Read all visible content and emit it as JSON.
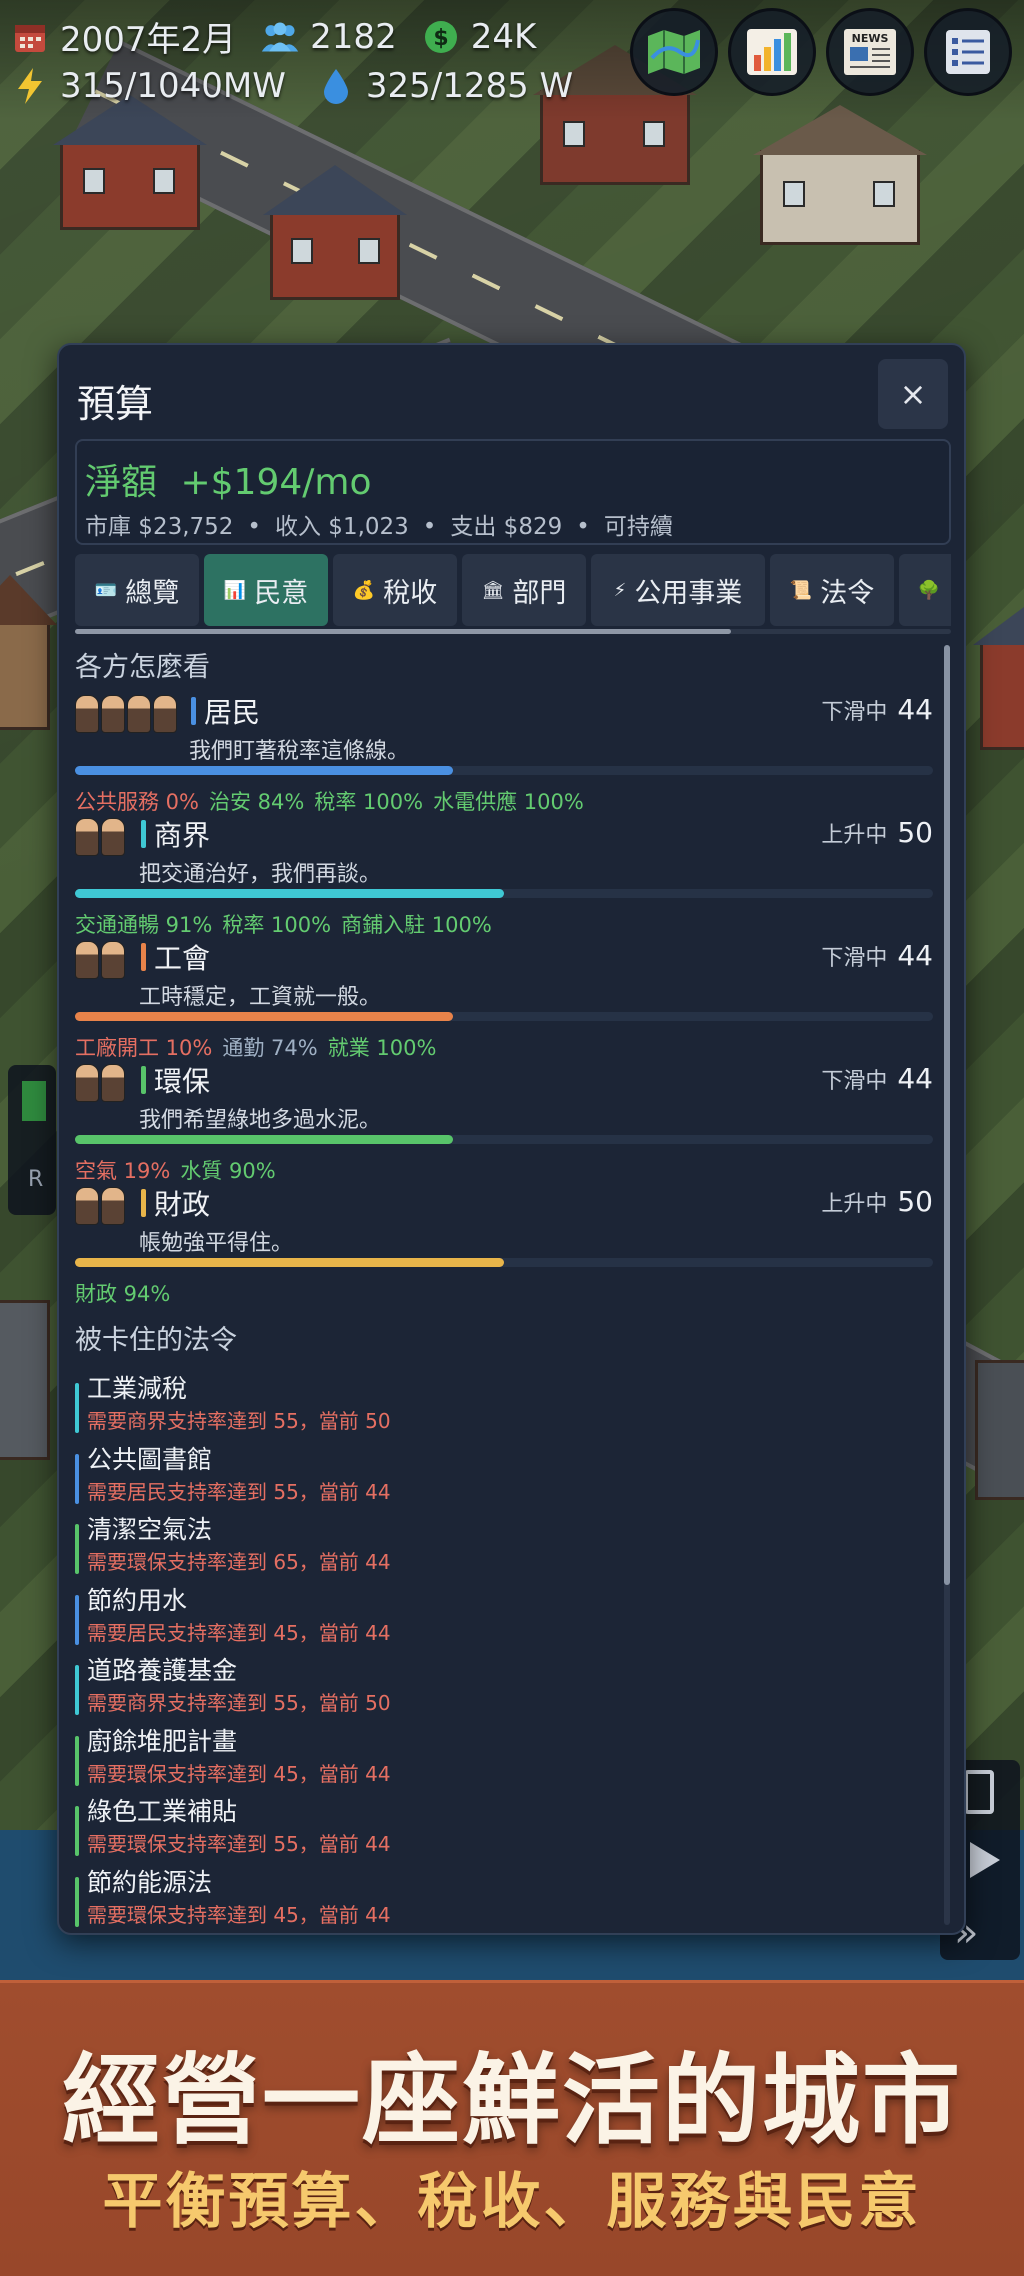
{
  "hud": {
    "date": "2007年2月",
    "population": "2182",
    "money": "24K",
    "power": "315/1040MW",
    "water": "325/1285 W",
    "icons": [
      "calendar-icon",
      "population-icon",
      "money-icon",
      "power-icon",
      "water-icon"
    ],
    "buttons": [
      "map-icon",
      "chart-icon",
      "news-icon",
      "list-icon"
    ],
    "news_label": "NEWS"
  },
  "panel": {
    "title": "預算",
    "close_label": "×",
    "net_label": "淨額",
    "net_value": "+$194/mo",
    "treasury": "市庫 $23,752",
    "income": "收入 $1,023",
    "expense": "支出 $829",
    "status": "可持續",
    "separator": "•",
    "tabs": [
      {
        "label": "總覽",
        "icon": "overview-icon"
      },
      {
        "label": "民意",
        "icon": "opinion-icon",
        "active": true
      },
      {
        "label": "稅收",
        "icon": "tax-icon"
      },
      {
        "label": "部門",
        "icon": "department-icon"
      },
      {
        "label": "公用事業",
        "icon": "utilities-icon"
      },
      {
        "label": "法令",
        "icon": "law-icon"
      }
    ],
    "opinion_heading": "各方怎麼看",
    "groups": [
      {
        "name": "居民",
        "quote": "我們盯著稅率這條線。",
        "trend": "下滑中",
        "score": "44",
        "accent": "#4a90e2",
        "fill_color": "#4a90e2",
        "fill": 0.44,
        "factors": [
          {
            "text": "公共服務 0%",
            "color": "#e56f62"
          },
          {
            "text": "治安 84%",
            "color": "#63cb70"
          },
          {
            "text": "稅率 100%",
            "color": "#63cb70"
          },
          {
            "text": "水電供應 100%",
            "color": "#63cb70"
          }
        ]
      },
      {
        "name": "商界",
        "quote": "把交通治好，我們再談。",
        "trend": "上升中",
        "score": "50",
        "accent": "#3fc8d4",
        "fill_color": "#3fc8d4",
        "fill": 0.5,
        "factors": [
          {
            "text": "交通通暢 91%",
            "color": "#63cb70"
          },
          {
            "text": "稅率 100%",
            "color": "#63cb70"
          },
          {
            "text": "商鋪入駐 100%",
            "color": "#63cb70"
          }
        ]
      },
      {
        "name": "工會",
        "quote": "工時穩定，工資就一般。",
        "trend": "下滑中",
        "score": "44",
        "accent": "#e8834a",
        "fill_color": "#e8834a",
        "fill": 0.44,
        "factors": [
          {
            "text": "工廠開工 10%",
            "color": "#e56f62"
          },
          {
            "text": "通勤 74%",
            "color": "#9fb0c4"
          },
          {
            "text": "就業 100%",
            "color": "#63cb70"
          }
        ]
      },
      {
        "name": "環保",
        "quote": "我們希望綠地多過水泥。",
        "trend": "下滑中",
        "score": "44",
        "accent": "#58c46a",
        "fill_color": "#58c46a",
        "fill": 0.44,
        "factors": [
          {
            "text": "空氣 19%",
            "color": "#e56f62"
          },
          {
            "text": "水質 90%",
            "color": "#63cb70"
          }
        ]
      },
      {
        "name": "財政",
        "quote": "帳勉強平得住。",
        "trend": "上升中",
        "score": "50",
        "accent": "#e8b54a",
        "fill_color": "#e8b54a",
        "fill": 0.5,
        "factors": [
          {
            "text": "財政 94%",
            "color": "#63cb70"
          }
        ]
      }
    ],
    "blocked_heading": "被卡住的法令",
    "laws": [
      {
        "name": "工業減稅",
        "requirement": "需要商界支持率達到 55，當前 50",
        "color": "#3fc8d4"
      },
      {
        "name": "公共圖書館",
        "requirement": "需要居民支持率達到 55，當前 44",
        "color": "#4a90e2"
      },
      {
        "name": "清潔空氣法",
        "requirement": "需要環保支持率達到 65，當前 44",
        "color": "#58c46a"
      },
      {
        "name": "節約用水",
        "requirement": "需要居民支持率達到 45，當前 44",
        "color": "#4a90e2"
      },
      {
        "name": "道路養護基金",
        "requirement": "需要商界支持率達到 55，當前 50",
        "color": "#3fc8d4"
      },
      {
        "name": "廚餘堆肥計畫",
        "requirement": "需要環保支持率達到 45，當前 44",
        "color": "#58c46a"
      },
      {
        "name": "綠色工業補貼",
        "requirement": "需要環保支持率達到 55，當前 44",
        "color": "#58c46a"
      },
      {
        "name": "節約能源法",
        "requirement": "需要環保支持率達到 45，當前 44",
        "color": "#58c46a"
      }
    ]
  },
  "side": {
    "peek_letter": "R"
  },
  "banner": {
    "headline": "經營一座鮮活的城市",
    "subheadline": "平衡預算、稅收、服務與民意"
  }
}
